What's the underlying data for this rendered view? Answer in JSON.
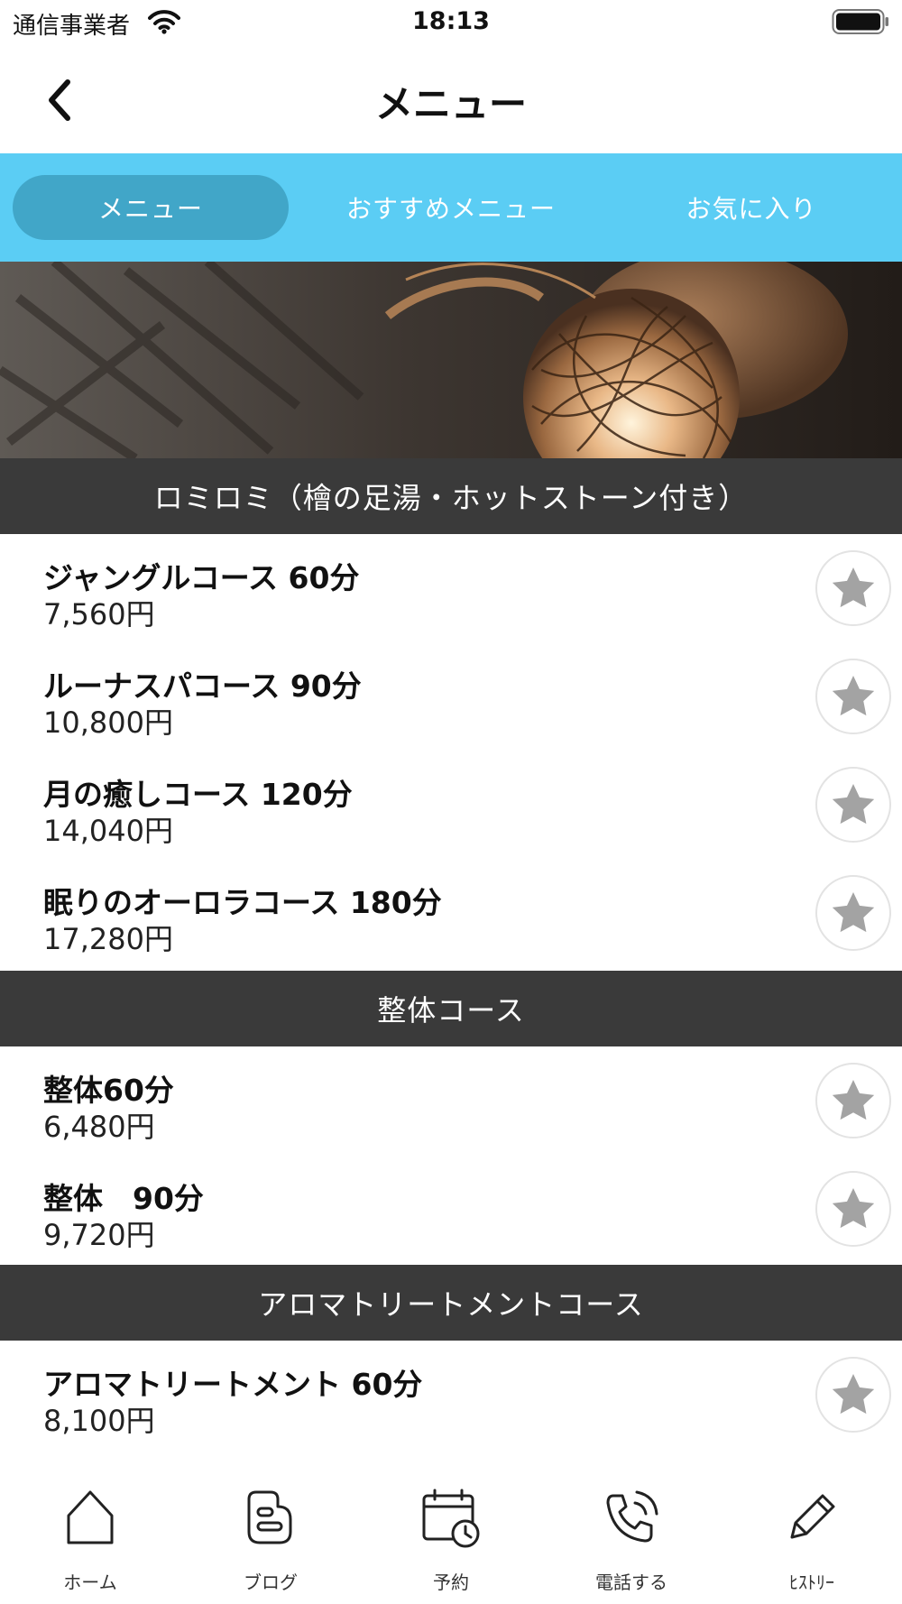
{
  "status_bar": {
    "carrier": "通信事業者",
    "time": "18:13"
  },
  "nav": {
    "title": "メニュー",
    "back_icon": "chevron-left-icon"
  },
  "tabs": [
    {
      "label": "メニュー",
      "active": true
    },
    {
      "label": "おすすめメニュー",
      "active": false
    },
    {
      "label": "お気に入り",
      "active": false
    }
  ],
  "sections": [
    {
      "title": "ロミロミ（檜の足湯・ホットストーン付き）",
      "items": [
        {
          "name": "ジャングルコース 60分",
          "price": "7,560円"
        },
        {
          "name": "ルーナスパコース 90分",
          "price": "10,800円"
        },
        {
          "name": "月の癒しコース 120分",
          "price": "14,040円"
        },
        {
          "name": "眠りのオーロラコース 180分",
          "price": "17,280円"
        }
      ]
    },
    {
      "title": "整体コース",
      "items": [
        {
          "name": "整体60分",
          "price": "6,480円"
        },
        {
          "name": "整体　90分",
          "price": "9,720円"
        }
      ]
    },
    {
      "title": "アロマトリートメントコース",
      "items": [
        {
          "name": "アロマトリートメント 60分",
          "price": "8,100円"
        }
      ]
    }
  ],
  "bottom_nav": [
    {
      "label": "ホーム",
      "icon": "home-icon"
    },
    {
      "label": "ブログ",
      "icon": "blog-icon"
    },
    {
      "label": "予約",
      "icon": "calendar-clock-icon"
    },
    {
      "label": "電話する",
      "icon": "phone-icon"
    },
    {
      "label": "ﾋｽﾄﾘｰ",
      "icon": "pencil-icon"
    }
  ],
  "colors": {
    "tab_bar": "#5bcdf4",
    "tab_active": "#41a6c8",
    "section_header": "#3a3a3a",
    "star": "#a3a3a3"
  }
}
